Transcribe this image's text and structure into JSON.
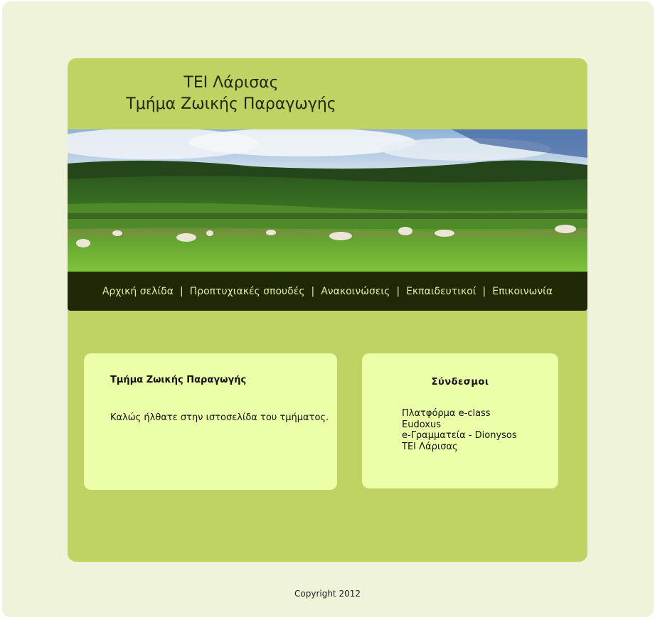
{
  "header": {
    "title_line1": "ΤΕΙ Λάρισας",
    "title_line2": "Τμήμα Ζωικής Παραγωγής"
  },
  "banner": {
    "image": "pasture-with-sheep-landscape"
  },
  "nav": {
    "items": [
      {
        "label": "Αρχική σελίδα"
      },
      {
        "label": "Προπτυχιακές σπουδές"
      },
      {
        "label": "Ανακοινώσεις"
      },
      {
        "label": "Εκπαιδευτικοί"
      },
      {
        "label": "Επικοινωνία"
      }
    ],
    "separator": "|"
  },
  "main": {
    "title": "Τμήμα Ζωικής Παραγωγής",
    "welcome": "Καλώς ήλθατε στην ιστοσελίδα του τμήματος."
  },
  "links": {
    "title": "Σύνδεσμοι",
    "items": [
      {
        "label": "Πλατφόρμα e-class"
      },
      {
        "label": "Eudoxus"
      },
      {
        "label": "e-Γραμματεία - Dionysos"
      },
      {
        "label": "ΤΕΙ Λάρισας"
      }
    ]
  },
  "footer": {
    "copyright": "Copyright 2012"
  },
  "colors": {
    "page_bg": "#eef3d9",
    "container": "#bed363",
    "navbar": "#1f2806",
    "nav_text": "#e4ee9f",
    "box": "#eaffa8"
  }
}
